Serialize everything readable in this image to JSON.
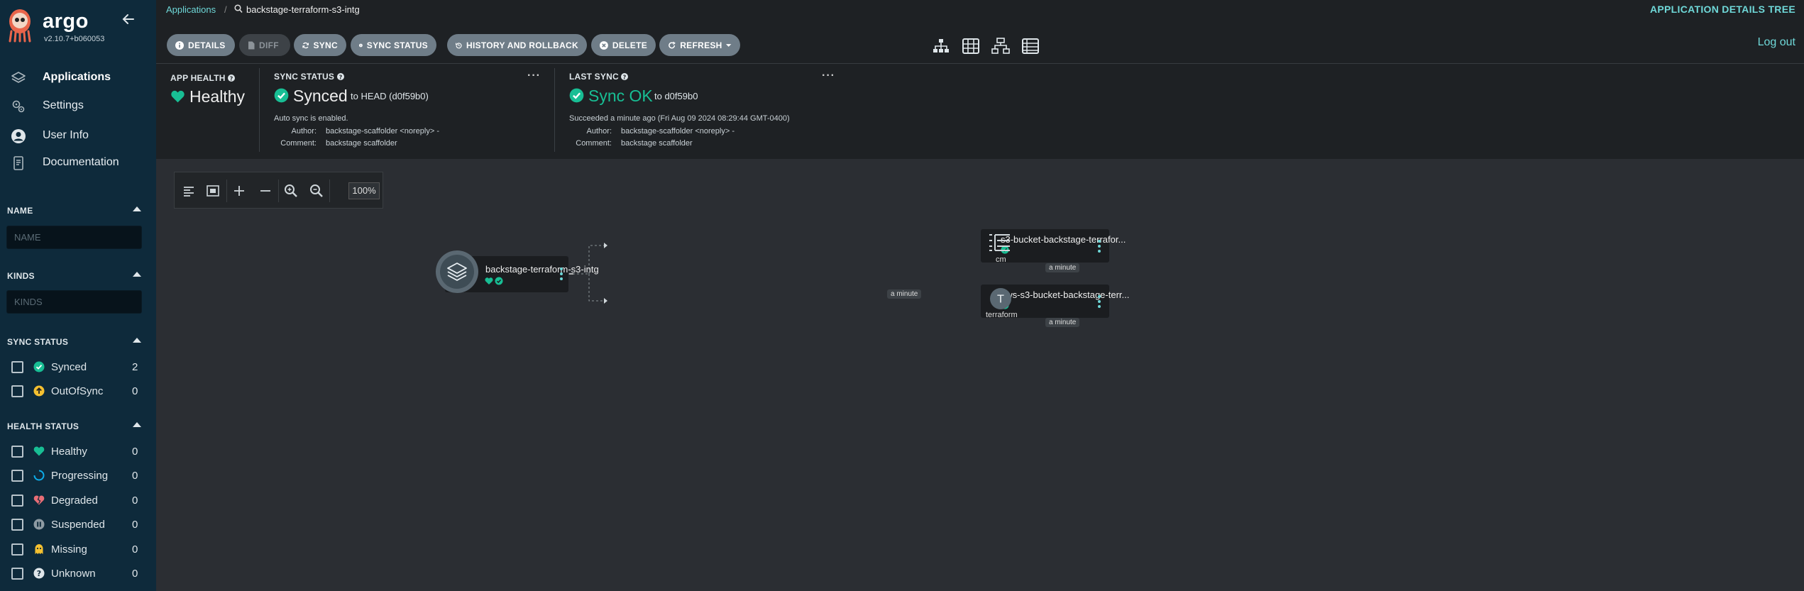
{
  "brand": {
    "name": "argo",
    "version": "v2.10.7+b060053"
  },
  "nav": [
    {
      "label": "Applications",
      "icon": "layers-icon"
    },
    {
      "label": "Settings",
      "icon": "gears-icon"
    },
    {
      "label": "User Info",
      "icon": "user-icon"
    },
    {
      "label": "Documentation",
      "icon": "docs-icon"
    }
  ],
  "filters": {
    "name": {
      "title": "NAME",
      "placeholder": "NAME"
    },
    "kinds": {
      "title": "KINDS",
      "placeholder": "KINDS"
    },
    "sync_status": {
      "title": "SYNC STATUS",
      "items": [
        {
          "label": "Synced",
          "count": "2",
          "icon": "synced-check-icon"
        },
        {
          "label": "OutOfSync",
          "count": "0",
          "icon": "out-of-sync-icon"
        }
      ]
    },
    "health_status": {
      "title": "HEALTH STATUS",
      "items": [
        {
          "label": "Healthy",
          "count": "0",
          "icon": "heart-icon"
        },
        {
          "label": "Progressing",
          "count": "0",
          "icon": "progress-circle-icon"
        },
        {
          "label": "Degraded",
          "count": "0",
          "icon": "broken-heart-icon"
        },
        {
          "label": "Suspended",
          "count": "0",
          "icon": "pause-icon"
        },
        {
          "label": "Missing",
          "count": "0",
          "icon": "ghost-icon"
        },
        {
          "label": "Unknown",
          "count": "0",
          "icon": "question-icon"
        }
      ]
    }
  },
  "topbar": {
    "breadcrumb_root": "Applications",
    "app_name": "backstage-terraform-s3-intg",
    "view_title": "APPLICATION DETAILS TREE"
  },
  "toolbar": {
    "details": "DETAILS",
    "diff": "DIFF",
    "sync": "SYNC",
    "sync_status": "SYNC STATUS",
    "history": "HISTORY AND ROLLBACK",
    "delete": "DELETE",
    "refresh": "REFRESH",
    "logout": "Log out"
  },
  "status": {
    "app_health": {
      "label": "APP HEALTH",
      "value": "Healthy"
    },
    "sync_status": {
      "label": "SYNC STATUS",
      "value": "Synced",
      "target": "to HEAD (d0f59b0)",
      "auto_sync": "Auto sync is enabled.",
      "author_key": "Author:",
      "author": "backstage-scaffolder <noreply> -",
      "comment_key": "Comment:",
      "comment": "backstage scaffolder"
    },
    "last_sync": {
      "label": "LAST SYNC",
      "value": "Sync OK",
      "target": "to d0f59b0",
      "when": "Succeeded a minute ago (Fri Aug 09 2024 08:29:44 GMT-0400)",
      "author_key": "Author:",
      "author": "backstage-scaffolder <noreply> -",
      "comment_key": "Comment:",
      "comment": "backstage scaffolder"
    }
  },
  "graph": {
    "zoom": "100%",
    "root": {
      "title": "backstage-terraform-s3-intg",
      "age": "a minute"
    },
    "children": [
      {
        "title": "s3-bucket-backstage-terrafor...",
        "kind": "cm",
        "age": "a minute"
      },
      {
        "title": "aws-s3-bucket-backstage-terr...",
        "kind": "terraform",
        "age": "a minute"
      }
    ]
  },
  "colors": {
    "sidebar": "#0e2a3b",
    "accent": "#6fd8d8",
    "healthy": "#18be94",
    "panel": "#1e2124",
    "canvas": "#2b2e33"
  }
}
